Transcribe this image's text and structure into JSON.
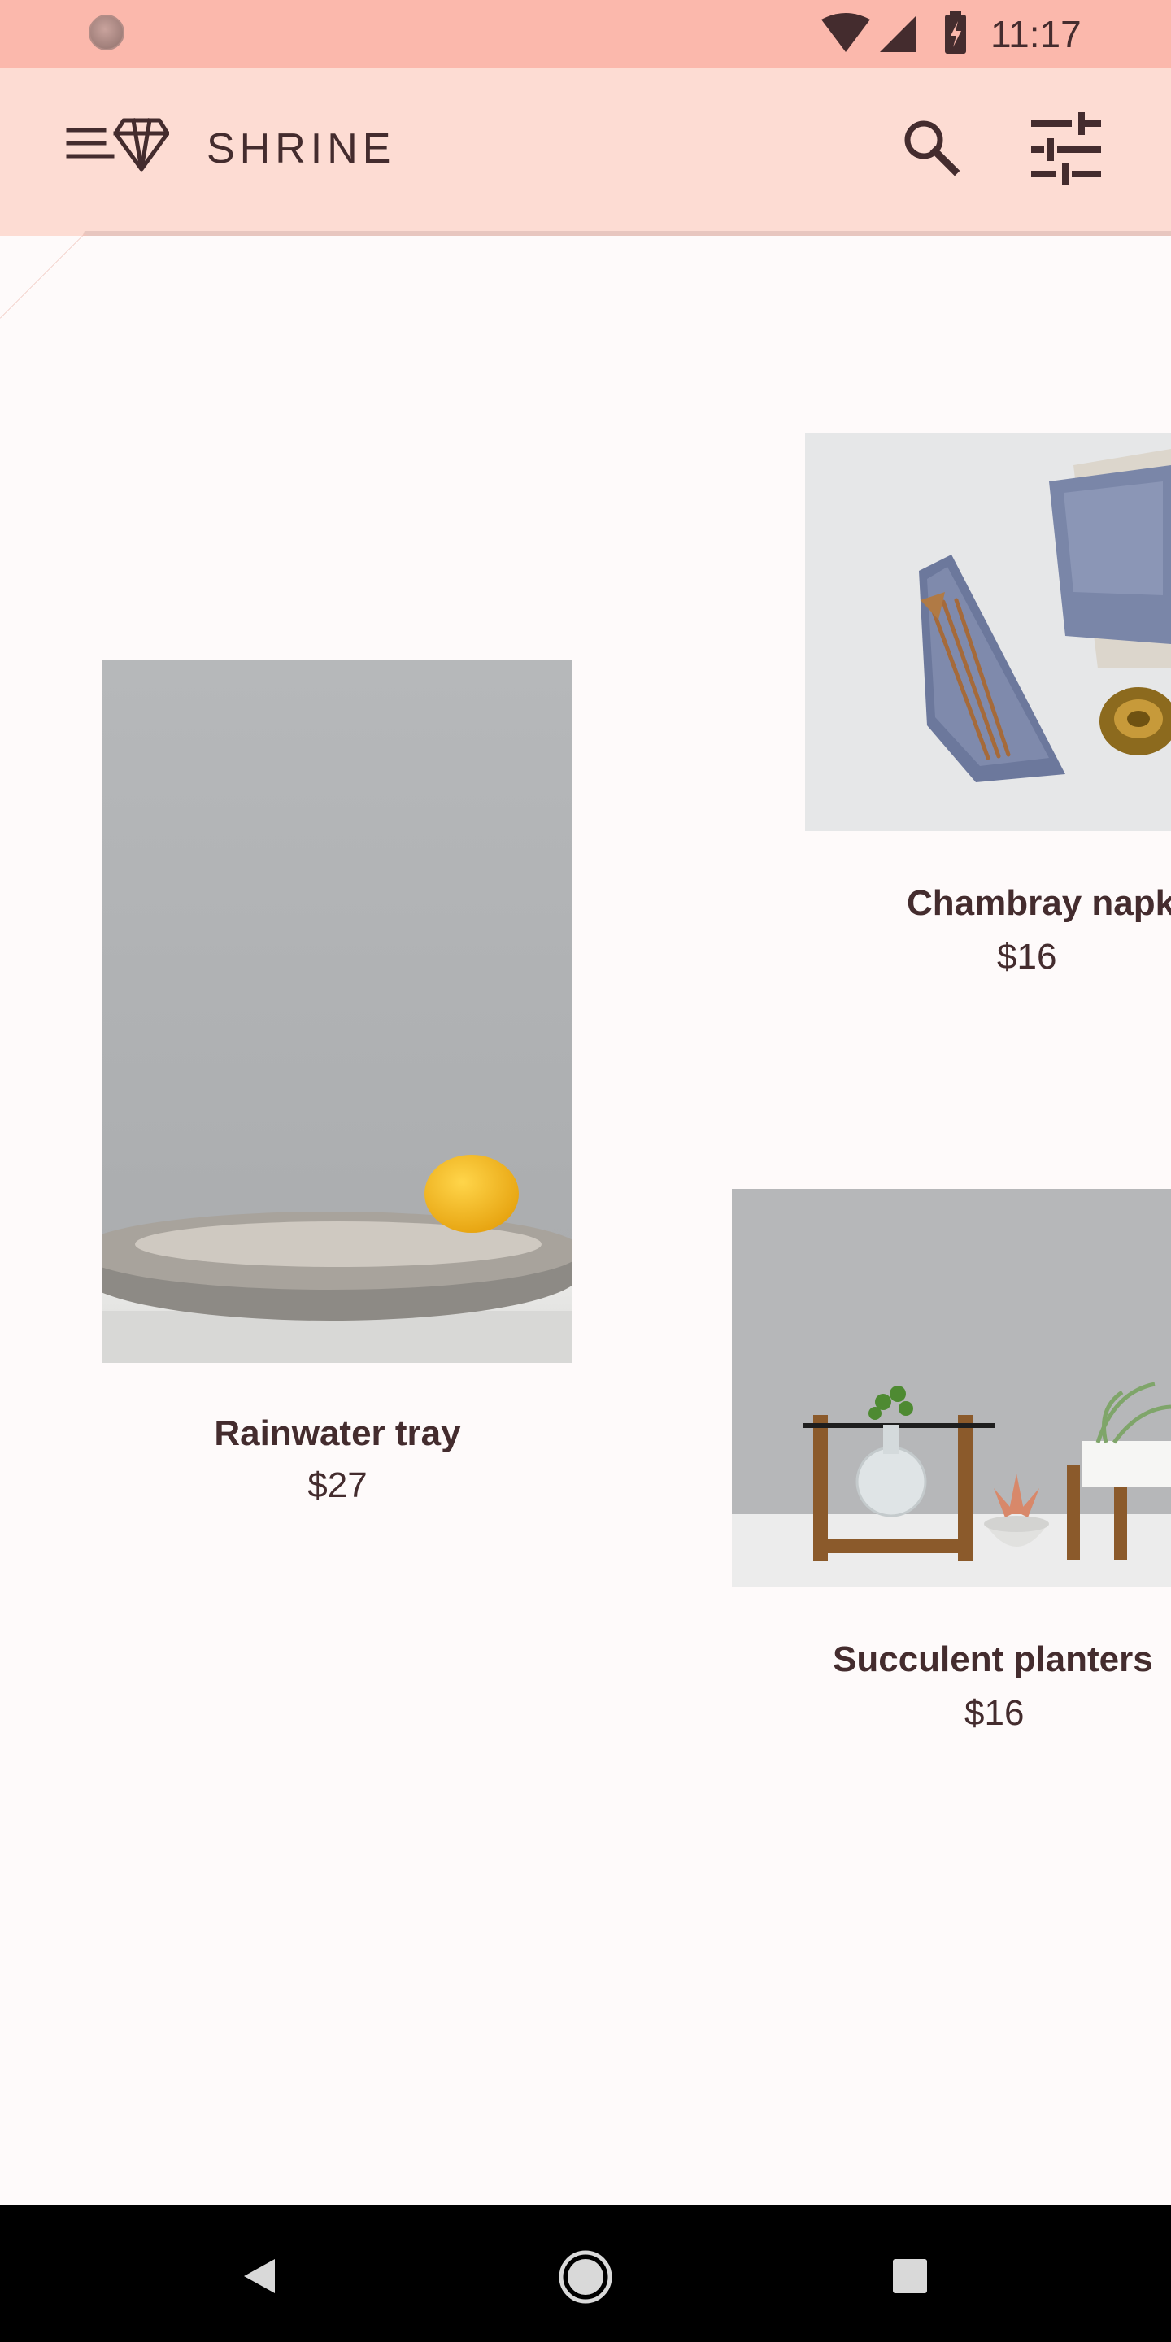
{
  "status_bar": {
    "time": "11:17"
  },
  "app_bar": {
    "title": "SHRINE",
    "menu_icon": "menu-diamond-icon",
    "search_icon": "search-icon",
    "filter_icon": "tune-icon"
  },
  "products": [
    {
      "name": "Rainwater tray",
      "price": "$27"
    },
    {
      "name": "Chambray napkins",
      "price": "$16"
    },
    {
      "name": "Succulent planters",
      "price": "$16"
    }
  ],
  "nav_bar": {
    "back_icon": "back-icon",
    "home_icon": "home-icon",
    "recents_icon": "recents-icon"
  },
  "colors": {
    "status_bar": "#fbb8ac",
    "app_bar": "#fddcd3",
    "surface": "#fefafa",
    "text": "#442c2e"
  }
}
